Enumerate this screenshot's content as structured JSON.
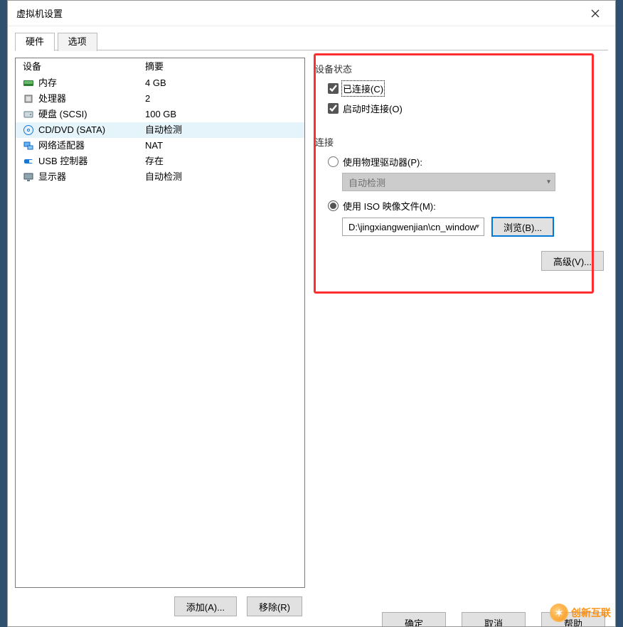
{
  "window": {
    "title": "虚拟机设置"
  },
  "tabs": {
    "hardware": "硬件",
    "options": "选项"
  },
  "columns": {
    "device": "设备",
    "summary": "摘要"
  },
  "devices": [
    {
      "icon": "memory-icon",
      "name": "内存",
      "summary": "4 GB"
    },
    {
      "icon": "cpu-icon",
      "name": "处理器",
      "summary": "2"
    },
    {
      "icon": "hdd-icon",
      "name": "硬盘 (SCSI)",
      "summary": "100 GB"
    },
    {
      "icon": "cd-icon",
      "name": "CD/DVD (SATA)",
      "summary": "自动检测",
      "selected": true
    },
    {
      "icon": "nic-icon",
      "name": "网络适配器",
      "summary": "NAT"
    },
    {
      "icon": "usb-icon",
      "name": "USB 控制器",
      "summary": "存在"
    },
    {
      "icon": "display-icon",
      "name": "显示器",
      "summary": "自动检测"
    }
  ],
  "left_buttons": {
    "add": "添加(A)...",
    "remove": "移除(R)"
  },
  "right": {
    "status_group": "设备状态",
    "connected_label": "已连接(C)",
    "connect_at_poweron_label": "启动时连接(O)",
    "connection_group": "连接",
    "use_physical_label": "使用物理驱动器(P):",
    "physical_dropdown": "自动检测",
    "use_iso_label": "使用 ISO 映像文件(M):",
    "iso_path": "D:\\jingxiangwenjian\\cn_window",
    "browse": "浏览(B)...",
    "advanced": "高级(V)..."
  },
  "footer": {
    "ok": "确定",
    "cancel": "取消",
    "help": "帮助"
  },
  "logo": {
    "text": "创新互联"
  },
  "colors": {
    "highlight": "#ff2d2d",
    "selection": "#e5f3fb"
  }
}
